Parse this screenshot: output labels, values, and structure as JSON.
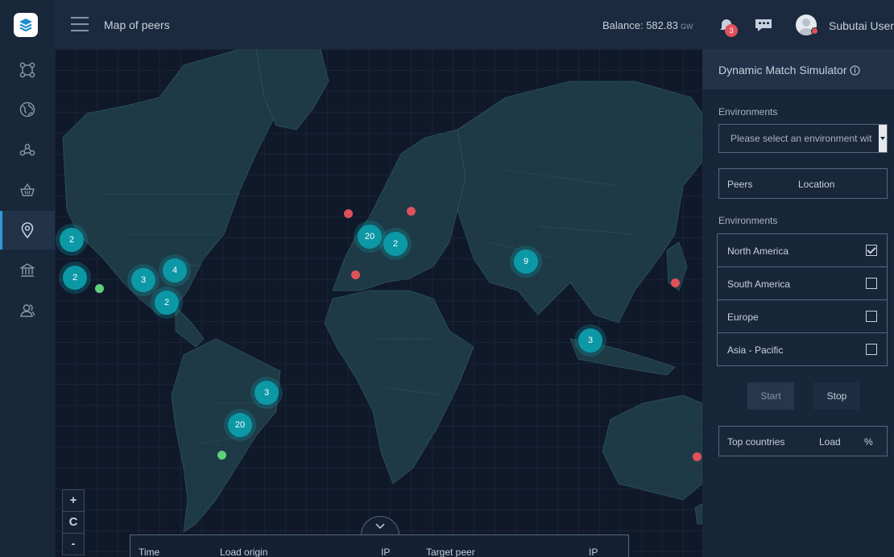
{
  "header": {
    "page_title": "Map of peers",
    "balance_label": "Balance: 582.83",
    "balance_unit": "GW",
    "notification_count": "3",
    "user_name": "Subutai User"
  },
  "sidebar": {
    "items": [
      {
        "icon": "nodes-icon"
      },
      {
        "icon": "globe-icon"
      },
      {
        "icon": "network-icon"
      },
      {
        "icon": "basket-icon"
      },
      {
        "icon": "location-pin-icon",
        "active": true
      },
      {
        "icon": "bank-icon"
      },
      {
        "icon": "user-group-icon"
      }
    ]
  },
  "map": {
    "clusters": [
      {
        "count": "2"
      },
      {
        "count": "2"
      },
      {
        "count": "3"
      },
      {
        "count": "4"
      },
      {
        "count": "2"
      },
      {
        "count": "20"
      },
      {
        "count": "2"
      },
      {
        "count": "9"
      },
      {
        "count": "3"
      },
      {
        "count": "3"
      },
      {
        "count": "20"
      }
    ],
    "zoom_controls": {
      "zoom_in": "+",
      "reset": "C",
      "zoom_out": "-"
    },
    "log_table": {
      "columns": [
        "Time",
        "Load origin",
        "IP",
        "Target peer",
        "IP"
      ]
    },
    "colors": {
      "cluster": "#0d98a6",
      "dot_red": "#e0515b",
      "dot_green": "#5fd07a"
    }
  },
  "panel": {
    "title": "Dynamic Match Simulator",
    "environments_label": "Environments",
    "environment_placeholder": "Please select an environment wit",
    "peers_header": {
      "peers": "Peers",
      "location": "Location"
    },
    "environments_label_2": "Environments",
    "regions": [
      {
        "label": "North America",
        "checked": true
      },
      {
        "label": "South America",
        "checked": false
      },
      {
        "label": "Europe",
        "checked": false
      },
      {
        "label": "Asia - Pacific",
        "checked": false
      }
    ],
    "start_label": "Start",
    "stop_label": "Stop",
    "countries_header": {
      "countries": "Top countries",
      "load": "Load",
      "percent": "%"
    }
  }
}
